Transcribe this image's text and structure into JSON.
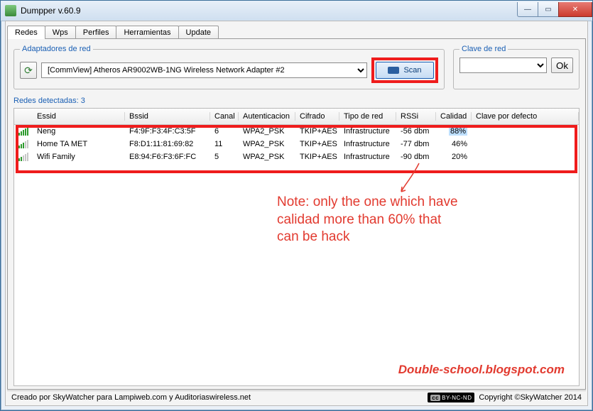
{
  "window": {
    "title": "Dumpper v.60.9"
  },
  "tabs": [
    "Redes",
    "Wps",
    "Perfiles",
    "Herramientas",
    "Update"
  ],
  "adapters": {
    "legend": "Adaptadores de red",
    "selected": "[CommView] Atheros AR9002WB-1NG Wireless Network Adapter #2",
    "scan_label": "Scan"
  },
  "clave": {
    "legend": "Clave de red",
    "value": "",
    "ok_label": "Ok"
  },
  "detected": {
    "label": "Redes detectadas:",
    "count": "3"
  },
  "columns": {
    "essid": "Essid",
    "bssid": "Bssid",
    "canal": "Canal",
    "auth": "Autenticacion",
    "cifrado": "Cifrado",
    "tipo": "Tipo de red",
    "rssi": "RSSi",
    "calidad": "Calidad",
    "defecto": "Clave por defecto"
  },
  "rows": [
    {
      "sig": "5",
      "essid": "Neng",
      "bssid": "F4:9F:F3:4F:C3:5F",
      "canal": "6",
      "auth": "WPA2_PSK",
      "cif": "TKIP+AES",
      "tipo": "Infrastructure",
      "rssi": "-56 dbm",
      "cal": "88%",
      "hl": true
    },
    {
      "sig": "3",
      "essid": "Home TA MET",
      "bssid": "F8:D1:11:81:69:82",
      "canal": "11",
      "auth": "WPA2_PSK",
      "cif": "TKIP+AES",
      "tipo": "Infrastructure",
      "rssi": "-77 dbm",
      "cal": "46%",
      "hl": false
    },
    {
      "sig": "2",
      "essid": "Wifi Family",
      "bssid": "E8:94:F6:F3:6F:FC",
      "canal": "5",
      "auth": "WPA2_PSK",
      "cif": "TKIP+AES",
      "tipo": "Infrastructure",
      "rssi": "-90 dbm",
      "cal": "20%",
      "hl": false
    }
  ],
  "note": {
    "line1": "Note: only the one which have",
    "line2": "calidad more than 60% that",
    "line3": "can be hack"
  },
  "watermark": "Double-school.blogspot.com",
  "status": {
    "left": "Creado por SkyWatcher para Lampiweb.com y Auditoriaswireless.net",
    "cc": "BY-NC-ND",
    "right": "Copyright ©SkyWatcher 2014"
  }
}
